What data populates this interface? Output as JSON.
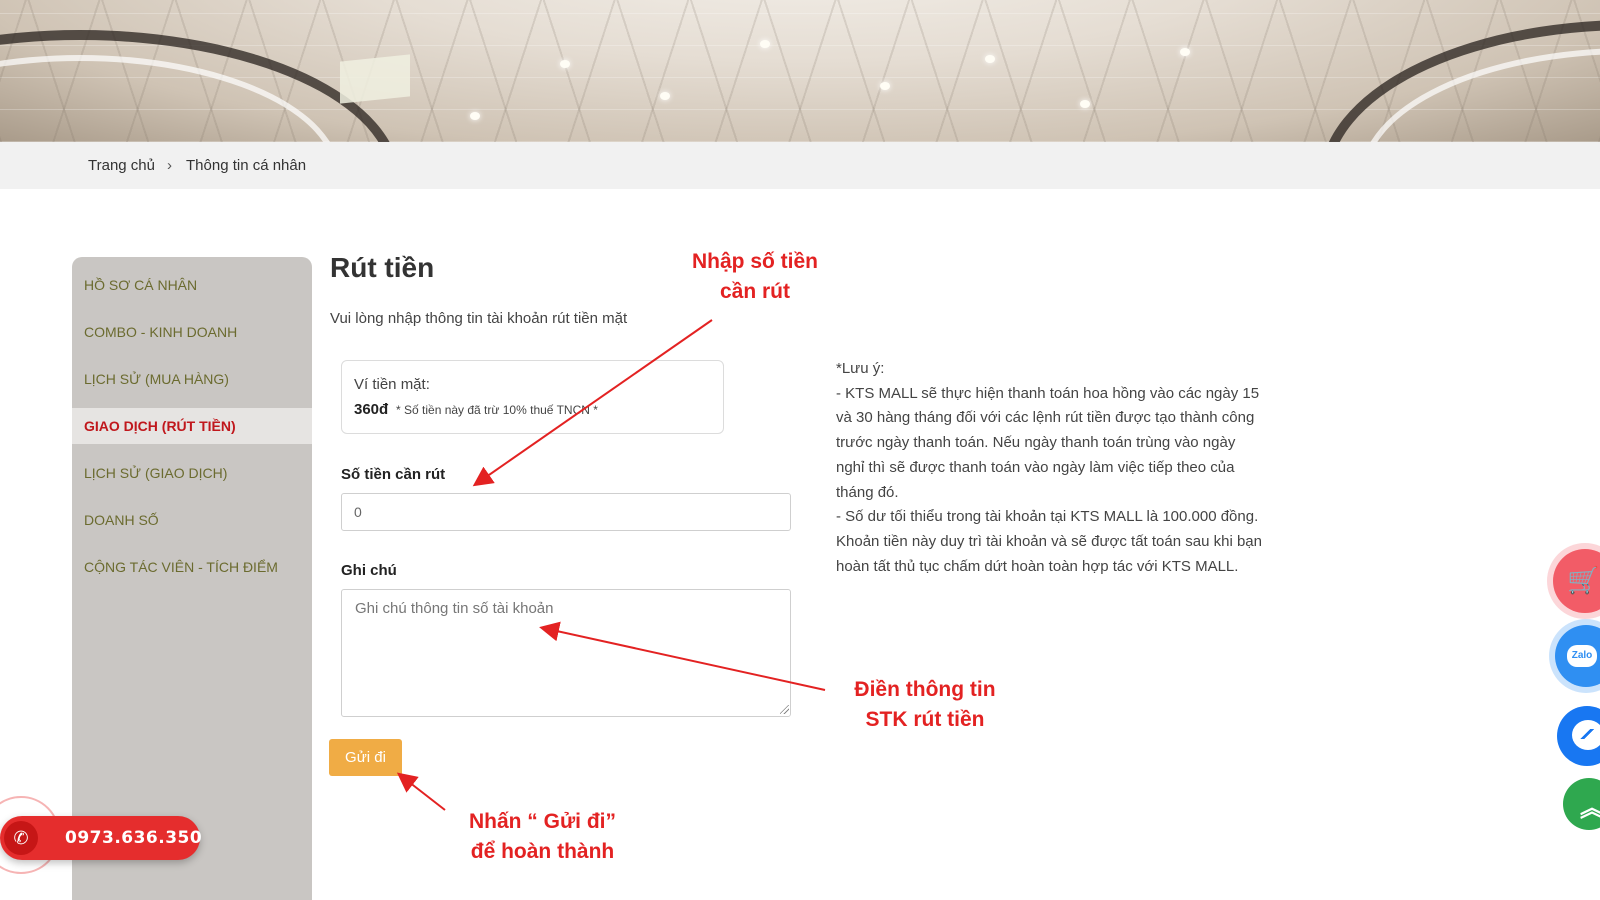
{
  "breadcrumb": {
    "home": "Trang chủ",
    "separator": "›",
    "current": "Thông tin cá nhân"
  },
  "sidebar": {
    "items": [
      {
        "label": "HỒ SƠ CÁ NHÂN",
        "active": false
      },
      {
        "label": "COMBO - KINH DOANH",
        "active": false
      },
      {
        "label": "LỊCH SỬ (MUA HÀNG)",
        "active": false
      },
      {
        "label": "GIAO DỊCH (RÚT TIỀN)",
        "active": true
      },
      {
        "label": "LỊCH SỬ (GIAO DỊCH)",
        "active": false
      },
      {
        "label": "DOANH SỐ",
        "active": false
      },
      {
        "label": "CỘNG TÁC VIÊN - TÍCH ĐIỂM",
        "active": false
      }
    ]
  },
  "main": {
    "title": "Rút tiền",
    "subtitle": "Vui lòng nhập thông tin tài khoản rút tiền mặt",
    "wallet": {
      "label": "Ví tiền mặt:",
      "amount": "360đ",
      "note": "* Số tiền này đã trừ 10% thuế TNCN *"
    },
    "amount_field": {
      "label": "Số tiền cần rút",
      "value": "0"
    },
    "note_field": {
      "label": "Ghi chú",
      "placeholder": "Ghi chú thông tin số tài khoản"
    },
    "submit_label": "Gửi đi"
  },
  "notice": {
    "title": "*Lưu ý:",
    "lines": [
      "- KTS MALL sẽ thực hiện thanh toán hoa hồng vào các ngày 15",
      "và 30 hàng tháng đối với các lệnh rút tiền được tạo thành công",
      "trước ngày thanh toán. Nếu ngày thanh toán trùng vào ngày",
      "nghỉ thì sẽ được thanh toán vào ngày làm việc tiếp theo của",
      "tháng đó.",
      "- Số dư tối thiểu trong tài khoản tại KTS MALL là 100.000 đồng.",
      "Khoản tiền này duy trì tài khoản và sẽ được tất toán sau khi bạn",
      "hoàn tất thủ tục chấm dứt hoàn toàn hợp tác với KTS MALL."
    ]
  },
  "annotations": {
    "enter_amount": [
      "Nhập số tiền",
      "cần rút"
    ],
    "fill_account": [
      "Điền thông tin",
      "STK rút tiền"
    ],
    "press_send": [
      "Nhấn “ Gửi đi”",
      "để hoàn thành"
    ],
    "color": "#e32222"
  },
  "floating": {
    "phone": "0973.636.350",
    "zalo_label": "Zalo",
    "icons": [
      "cart-icon",
      "zalo-icon",
      "messenger-icon",
      "scroll-top-icon",
      "phone-icon"
    ]
  },
  "colors": {
    "sidebar_bg": "#c9c6c3",
    "sidebar_text": "#6b6b2f",
    "sidebar_active": "#c0171c",
    "submit_bg": "#f0ac45",
    "phone_bg": "#e52d2d"
  }
}
